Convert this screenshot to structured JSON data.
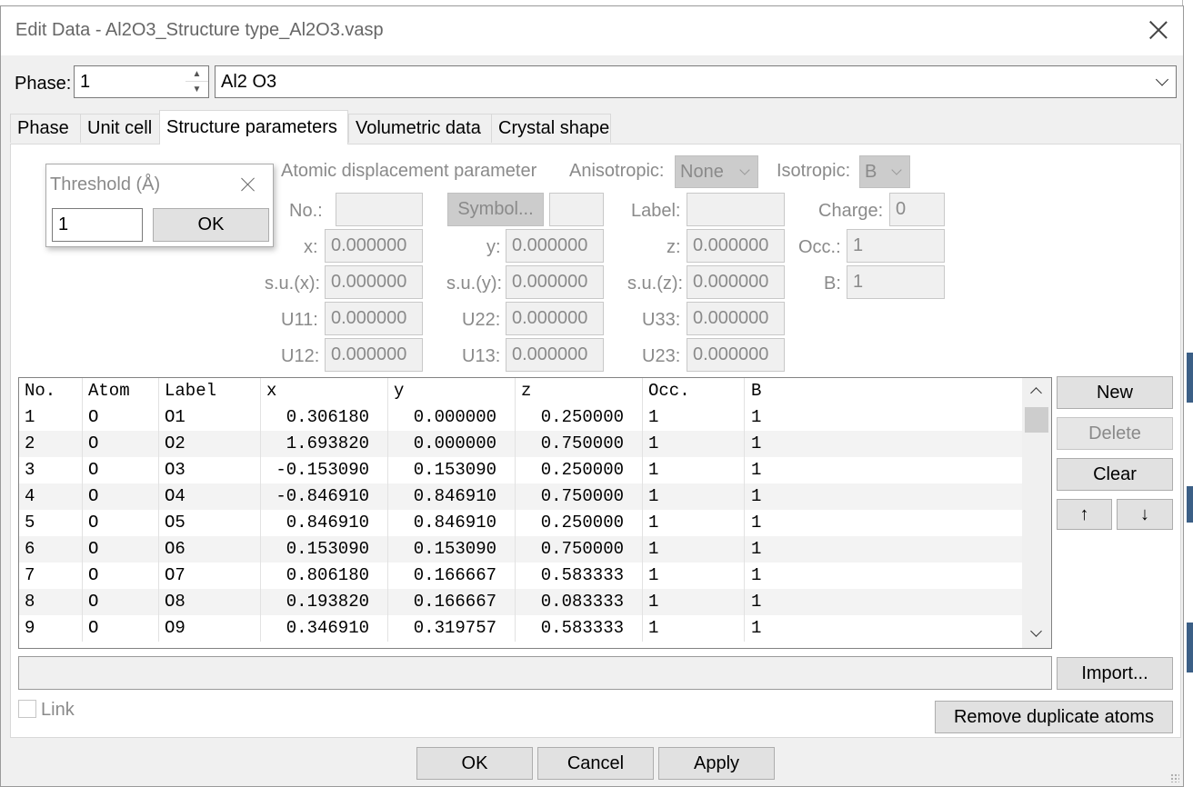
{
  "window": {
    "title": "Edit Data - Al2O3_Structure type_Al2O3.vasp"
  },
  "phase": {
    "label": "Phase:",
    "value": "1",
    "name": "Al2 O3"
  },
  "tabs": [
    "Phase",
    "Unit cell",
    "Structure parameters",
    "Volumetric data",
    "Crystal shape"
  ],
  "active_tab": "Structure parameters",
  "threshold_popup": {
    "title": "Threshold (Å)",
    "value": "1",
    "ok": "OK"
  },
  "adp": {
    "heading": "Atomic displacement parameter",
    "anisotropic_label": "Anisotropic:",
    "anisotropic_value": "None",
    "isotropic_label": "Isotropic:",
    "isotropic_value": "B"
  },
  "fields": {
    "no_label": "No.:",
    "no_value": "",
    "symbol_button": "Symbol...",
    "symbol_value": "",
    "label_label": "Label:",
    "label_value": "",
    "charge_label": "Charge:",
    "charge_value": "0",
    "x_label": "x:",
    "x_value": "0.000000",
    "y_label": "y:",
    "y_value": "0.000000",
    "z_label": "z:",
    "z_value": "0.000000",
    "occ_label": "Occ.:",
    "occ_value": "1",
    "sux_label": "s.u.(x):",
    "sux_value": "0.000000",
    "suy_label": "s.u.(y):",
    "suy_value": "0.000000",
    "suz_label": "s.u.(z):",
    "suz_value": "0.000000",
    "b_label": "B:",
    "b_value": "1",
    "u11_label": "U11:",
    "u11_value": "0.000000",
    "u22_label": "U22:",
    "u22_value": "0.000000",
    "u33_label": "U33:",
    "u33_value": "0.000000",
    "u12_label": "U12:",
    "u12_value": "0.000000",
    "u13_label": "U13:",
    "u13_value": "0.000000",
    "u23_label": "U23:",
    "u23_value": "0.000000"
  },
  "table": {
    "headers": [
      "No.",
      "Atom",
      "Label",
      "x",
      "y",
      "z",
      "Occ.",
      "B"
    ],
    "rows": [
      [
        "1",
        "O",
        "O1",
        "0.306180",
        "0.000000",
        "0.250000",
        "1",
        "1"
      ],
      [
        "2",
        "O",
        "O2",
        "1.693820",
        "0.000000",
        "0.750000",
        "1",
        "1"
      ],
      [
        "3",
        "O",
        "O3",
        "-0.153090",
        "0.153090",
        "0.250000",
        "1",
        "1"
      ],
      [
        "4",
        "O",
        "O4",
        "-0.846910",
        "0.846910",
        "0.750000",
        "1",
        "1"
      ],
      [
        "5",
        "O",
        "O5",
        "0.846910",
        "0.846910",
        "0.250000",
        "1",
        "1"
      ],
      [
        "6",
        "O",
        "O6",
        "0.153090",
        "0.153090",
        "0.750000",
        "1",
        "1"
      ],
      [
        "7",
        "O",
        "O7",
        "0.806180",
        "0.166667",
        "0.583333",
        "1",
        "1"
      ],
      [
        "8",
        "O",
        "O8",
        "0.193820",
        "0.166667",
        "0.083333",
        "1",
        "1"
      ],
      [
        "9",
        "O",
        "O9",
        "0.346910",
        "0.319757",
        "0.583333",
        "1",
        "1"
      ]
    ]
  },
  "side_buttons": {
    "new": "New",
    "delete": "Delete",
    "clear": "Clear",
    "up": "↑",
    "down": "↓"
  },
  "import_path": "",
  "import_button": "Import...",
  "link_label": "Link",
  "remove_dup_button": "Remove duplicate atoms",
  "footer": {
    "ok": "OK",
    "cancel": "Cancel",
    "apply": "Apply"
  }
}
